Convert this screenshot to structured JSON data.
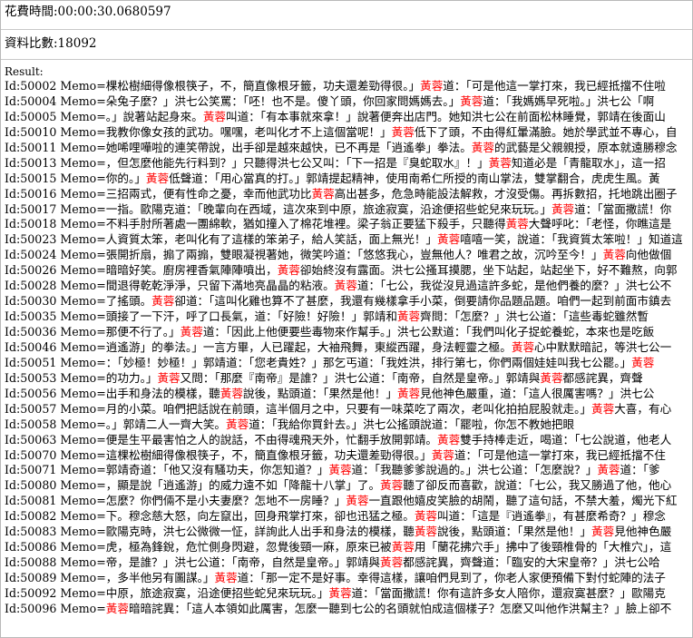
{
  "header": {
    "elapsed": "花費時間:00:00:30.0680597",
    "count": "資料比數:18092"
  },
  "result_label": "Result:",
  "highlight_color": "#ff0000",
  "records": [
    {
      "id": "Id:50002",
      "memo": "Memo=棵松樹細得像根筷子，不，簡直像根牙籤，功夫還差勁得很。」黃蓉道：「可是他這一掌打來，我已經抵擋不住啦"
    },
    {
      "id": "Id:50004",
      "memo": "Memo=朵兔子麼？」洪七公笑罵：「呸！也不是。傻丫頭，你回家問媽媽去。」黃蓉道：「我媽媽早死啦。」洪七公「啊"
    },
    {
      "id": "Id:50005",
      "memo": "Memo=。」說著站起身來。黃蓉叫道：「有本事就來拿！」說著便奔出店門。她知洪七公在前面松林睡覺，郭靖在後面山"
    },
    {
      "id": "Id:50010",
      "memo": "Memo=我教你像女孩的武功。嘿嘿，老叫化才不上這個當呢！」黃蓉低下了頭，不由得紅暈滿臉。她於學武並不專心，自"
    },
    {
      "id": "Id:50011",
      "memo": "Memo=她唏哩嘩啦的連笑帶說，出手卻是越來越快，已不再是「逍遙拳」拳法。黃蓉的武藝是父親親授，原本就遠勝穆念"
    },
    {
      "id": "Id:50013",
      "memo": "Memo=，但怎麼他能先行料到？」只聽得洪七公又叫：「下一招是『臭蛇取水』！」黃蓉知道必是「青龍取水」，這一招"
    },
    {
      "id": "Id:50015",
      "memo": "Memo=你的。」黃蓉低聲道：「用心當真的打。」郭靖提起精神，使用南希仁所授的南山掌法，雙掌翻合，虎虎生風。黃"
    },
    {
      "id": "Id:50016",
      "memo": "Memo=三招兩式，便有性命之憂，幸而他武功比黃蓉高出甚多，危急時能設法解救，才沒受傷。再拆數招，托地跳出圈子"
    },
    {
      "id": "Id:50017",
      "memo": "Memo=一指。歐陽克道：「晚輩向在西域，這次來到中原，旅途寂寞，沿途便招些蛇兒來玩玩。」黃蓉道：「當面撒謊！你"
    },
    {
      "id": "Id:50018",
      "memo": "Memo=不料手肘所著處一團綿軟，猶如撞入了棉花堆裡。梁子翁正要猛下殺手，只聽得黃蓉大聲呼叱：「老怪，你瞧這是"
    },
    {
      "id": "Id:50023",
      "memo": "Memo=人資質太笨，老叫化有了這樣的笨弟子，給人笑話，面上無光！」黃蓉嘻嘻一笑，說道：「我資質太笨啦！」知道這"
    },
    {
      "id": "Id:50024",
      "memo": "Memo=張開折扇，搧了兩搧，雙眼凝視著她，微笑吟道：「悠悠我心，豈無他人？唯君之故，沉吟至今！」黃蓉向他做個"
    },
    {
      "id": "Id:50026",
      "memo": "Memo=暗暗好笑。廚房裡香氣陣陣噴出，黃蓉卻始終沒有露面。洪七公搔耳摸腮，坐下站起，站起坐下，好不難熬，向郭"
    },
    {
      "id": "Id:50028",
      "memo": "Memo=間退得乾乾淨淨，只留下滿地亮晶晶的粘液。黃蓉道：「七公，我從沒見過這許多蛇，是他們養的麼？」洪七公不"
    },
    {
      "id": "Id:50030",
      "memo": "Memo=了搖頭。黃蓉卻道：「這叫化雞也算不了甚麼，我還有幾樣拿手小菜，倒要請你品題品題。咱們一起到前面市鎮去"
    },
    {
      "id": "Id:50035",
      "memo": "Memo=頭接了一下汗，呼了口長氣，道：「好險！好險！」郭靖和黃蓉齊問：「怎麼？」洪七公道：「這些毒蛇雖然暫"
    },
    {
      "id": "Id:50036",
      "memo": "Memo=那便不行了。」黃蓉道：「因此上他便要些毒物來作幫手。」洪七公默道：「我們叫化子捉蛇養蛇，本來也是吃飯"
    },
    {
      "id": "Id:50046",
      "memo": "Memo=逍遙游」的拳法。」一言方畢，人已躍起，大袖飛舞，東縱西躍，身法輕靈之極。黃蓉心中默默暗記，等洪七公一"
    },
    {
      "id": "Id:50051",
      "memo": "Memo=：「妙極！妙極！」郭靖道：「您老貴姓？」那乞丐道：「我姓洪，排行第七，你們兩個娃娃叫我七公罷。」黃蓉"
    },
    {
      "id": "Id:50053",
      "memo": "Memo=的功力。」黃蓉又問：「那麼『南帝』是誰？」洪七公道：「南帝，自然是皇帝。」郭靖與黃蓉都感詫異，齊聲"
    },
    {
      "id": "Id:50056",
      "memo": "Memo=出手和身法的模樣，聽黃蓉說後，點頭道：「果然是他！」黃蓉見他神色嚴重，道：「這人很厲害嗎？」洪七公"
    },
    {
      "id": "Id:50057",
      "memo": "Memo=月的小菜。咱們把話說在前頭，這半個月之中，只要有一味菜吃了兩次，老叫化拍拍屁股就走。」黃蓉大喜，有心"
    },
    {
      "id": "Id:50058",
      "memo": "Memo=。」郭靖二人一齊大笑。黃蓉道：「我給你買針去。」洪七公搖頭說道：「罷啦，你怎不教她把眼"
    },
    {
      "id": "Id:50063",
      "memo": "Memo=便是生平最害怕之人的說話，不由得魂飛天外，忙翻手放開郭靖。黃蓉雙手持棒走近，喝道：「七公說道，他老人"
    },
    {
      "id": "Id:50070",
      "memo": "Memo=這棵松樹細得像根筷子，不，簡直像根牙籤，功夫還差勁得很。」黃蓉道：「可是他這一掌打來，我已經抵擋不住"
    },
    {
      "id": "Id:50071",
      "memo": "Memo=郭靖奇道：「他又沒有騷功夫，你怎知道？」黃蓉道：「我聽爹爹說過的。」洪七公道：「怎麼說？」黃蓉道：「爹"
    },
    {
      "id": "Id:50080",
      "memo": "Memo=，顯是說「逍遙游」的威力遠不如「降龍十八掌」了。黃蓉聽了卻反而喜歡，說道：「七公，我又勝過了他，他心"
    },
    {
      "id": "Id:50081",
      "memo": "Memo=怎麼？你們倆不是小夫妻麼？怎地不一房睡？」黃蓉一直跟他嬉皮笑臉的胡鬧，聽了這句話，不禁大羞，燭光下紅"
    },
    {
      "id": "Id:50082",
      "memo": "Memo=下。穆念慈大怒，向左竄出，回身飛掌打來，卻也迅猛之極。黃蓉叫道：「這是『逍遙拳』，有甚麼希奇？」穆念"
    },
    {
      "id": "Id:50083",
      "memo": "Memo=歐陽克時，洪七公微微一怔，詳詢此人出手和身法的模樣，聽黃蓉說後，點頭道：「果然是他！」黃蓉見他神色嚴"
    },
    {
      "id": "Id:50086",
      "memo": "Memo=虎，極為鋒銳，危忙側身閃避，忽覺後頸一麻，原來已被黃蓉用「蘭花拂穴手」拂中了後頸椎骨的「大椎穴」，這"
    },
    {
      "id": "Id:50088",
      "memo": "Memo=帝，是誰？」洪七公道：「南帝，自然是皇帝。」郭靖與黃蓉都感詫異，齊聲道：「臨安的大宋皇帝？」洪七公哈"
    },
    {
      "id": "Id:50089",
      "memo": "Memo=，多半他另有圖謀。」黃蓉道：「那一定不是好事。幸得這樣，讓咱們見到了，你老人家便預備下對付蛇陣的法子"
    },
    {
      "id": "Id:50092",
      "memo": "Memo=中原，旅途寂寞，沿途便招些蛇兒來玩玩。」黃蓉道：「當面撒謊！你有這許多女人陪你，還寂寞甚麼？」歐陽克"
    },
    {
      "id": "Id:50096",
      "memo": "Memo=黃蓉暗暗詫異：「這人本領如此厲害，怎麼一聽到七公的名頭就怕成這個樣子？怎麼又叫他作洪幫主？」臉上卻不"
    }
  ]
}
